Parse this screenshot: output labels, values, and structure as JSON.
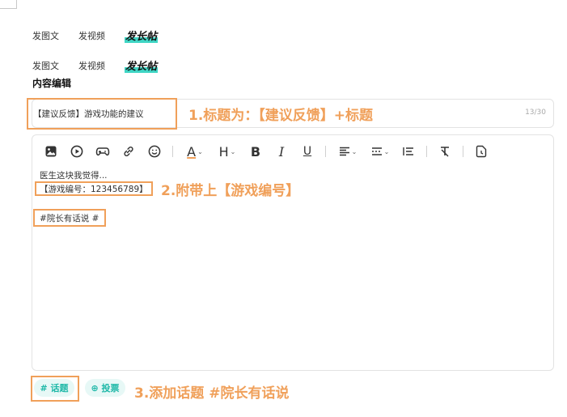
{
  "tabs_top": [
    "发图文",
    "发视频",
    "发长帖"
  ],
  "tabs_bottom": [
    "发图文",
    "发视频",
    "发长帖"
  ],
  "section_title": "内容编辑",
  "title_field": {
    "value": "【建议反馈】游戏功能的建议",
    "counter": "13/30"
  },
  "annotations": {
    "title": "1.标题为：【建议反馈】+标题",
    "game": "2.附带上【游戏编号】",
    "topic": "3.添加话题 #院长有话说"
  },
  "editor": {
    "line1": "医生这块我觉得...",
    "game_number": "【游戏编号：123456789】",
    "topic_tag": "#院长有话说 #",
    "toolbar": [
      "image-icon",
      "video-icon",
      "gamepad-icon",
      "link-icon",
      "emoji-icon",
      "font-color-icon",
      "heading-icon",
      "bold-icon",
      "italic-icon",
      "underline-icon",
      "align-icon",
      "divider-style-icon",
      "list-indent-icon",
      "clear-format-icon",
      "history-icon"
    ],
    "font_color_glyph": "A",
    "heading_glyph": "H",
    "bold_glyph": "B",
    "italic_glyph": "I",
    "underline_glyph": "U"
  },
  "buttons": {
    "topic": "# 话题",
    "vote": "⊕ 投票"
  },
  "accent_color": "#3fd5c4",
  "annotation_color": "#f0a05a"
}
